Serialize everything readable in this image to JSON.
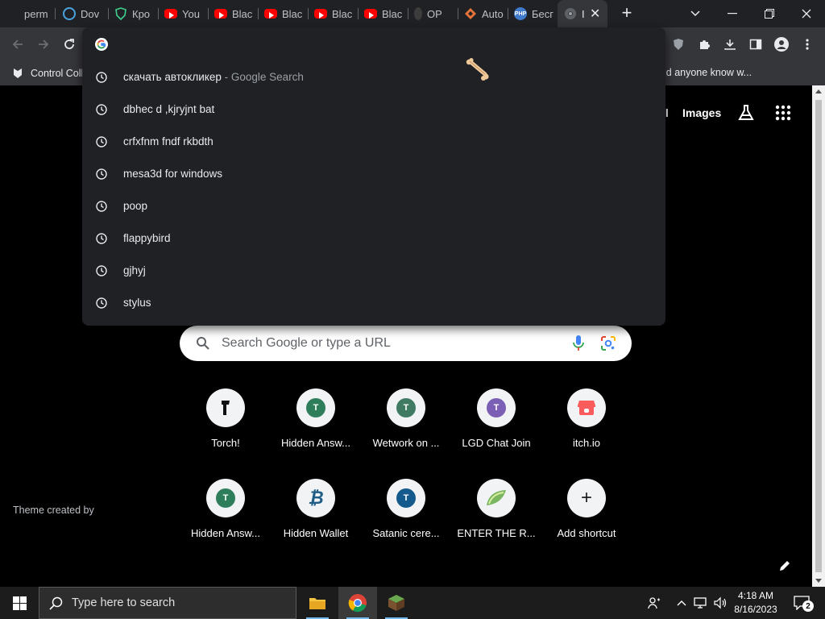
{
  "tabs": [
    {
      "title": "perm",
      "favicon": "doc-icon"
    },
    {
      "title": "Dov",
      "favicon": "download-icon"
    },
    {
      "title": "Кро",
      "favicon": "shield-icon"
    },
    {
      "title": "You",
      "favicon": "youtube-icon"
    },
    {
      "title": "Blac",
      "favicon": "youtube-icon"
    },
    {
      "title": "Blac",
      "favicon": "youtube-icon"
    },
    {
      "title": "Blac",
      "favicon": "youtube-icon"
    },
    {
      "title": "Blac",
      "favicon": "youtube-icon"
    },
    {
      "title": "OP",
      "favicon": "generic-icon"
    },
    {
      "title": "Auto",
      "favicon": "diamond-icon"
    },
    {
      "title": "Бесг",
      "favicon": "php-icon"
    },
    {
      "title": "I",
      "favicon": "chrome-icon",
      "active": true
    }
  ],
  "bookmarks": {
    "first": "Control Coll",
    "last": "id anyone know w..."
  },
  "omnibox": {
    "suggestions": [
      {
        "text": "скачать автокликер",
        "hint": " - Google Search"
      },
      {
        "text": "dbhec d ,kjryjnt bat",
        "hint": ""
      },
      {
        "text": "crfxfnm fndf rkbdth",
        "hint": ""
      },
      {
        "text": "mesa3d for windows",
        "hint": ""
      },
      {
        "text": "poop",
        "hint": ""
      },
      {
        "text": "flappybird",
        "hint": ""
      },
      {
        "text": "gjhyj",
        "hint": ""
      },
      {
        "text": "stylus",
        "hint": ""
      }
    ]
  },
  "header_links": {
    "gmail_partial": "il",
    "images": "Images"
  },
  "search": {
    "placeholder": "Search Google or type a URL"
  },
  "shortcuts": [
    {
      "label": "Torch!",
      "icon": "torch-icon",
      "letter": "",
      "color": "#000000"
    },
    {
      "label": "Hidden Answ...",
      "icon": "letter-icon",
      "letter": "T",
      "color": "#2e7d5b"
    },
    {
      "label": "Wetwork on ...",
      "icon": "letter-icon",
      "letter": "T",
      "color": "#3f7a63"
    },
    {
      "label": "LGD Chat Join",
      "icon": "letter-icon",
      "letter": "T",
      "color": "#7b5fb5"
    },
    {
      "label": "itch.io",
      "icon": "itch-icon",
      "letter": "",
      "color": "#fa5c5c"
    },
    {
      "label": "Hidden Answ...",
      "icon": "letter-icon",
      "letter": "T",
      "color": "#2e7d5b"
    },
    {
      "label": "Hidden Wallet",
      "icon": "bitcoin-icon",
      "letter": "₿",
      "color": "#1e5d86"
    },
    {
      "label": "Satanic cere...",
      "icon": "letter-icon",
      "letter": "T",
      "color": "#145a8c"
    },
    {
      "label": "ENTER THE R...",
      "icon": "melon-icon",
      "letter": "",
      "color": "#7bb661"
    },
    {
      "label": "Add shortcut",
      "icon": "plus-icon",
      "letter": "+",
      "color": "#202124"
    }
  ],
  "theme_credit": "Theme created by",
  "taskbar": {
    "search_placeholder": "Type here to search",
    "time": "4:18 AM",
    "date": "8/16/2023",
    "notification_count": "2"
  }
}
